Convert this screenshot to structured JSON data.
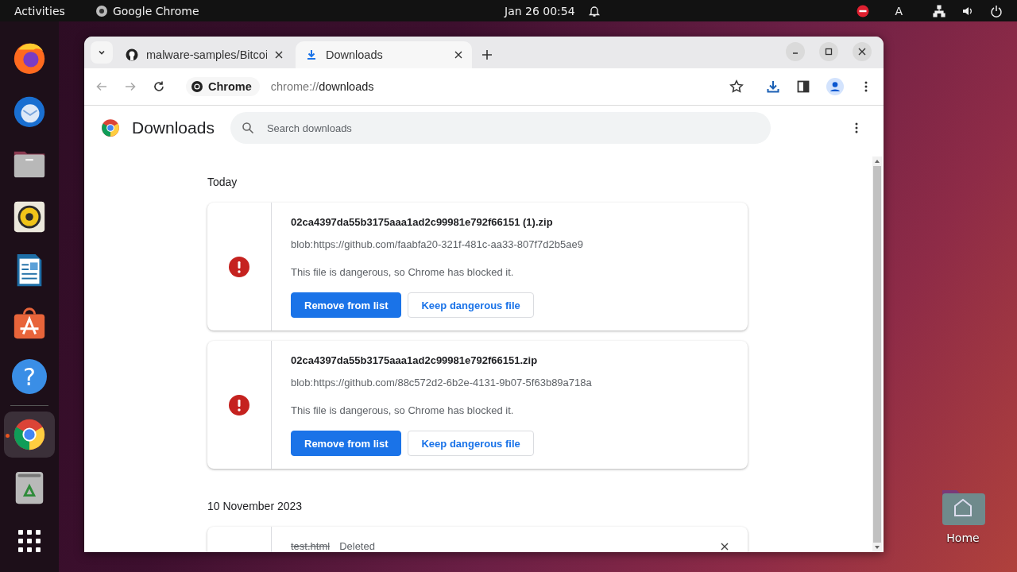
{
  "topbar": {
    "activities": "Activities",
    "app": "Google Chrome",
    "clock": "Jan 26  00:54",
    "keyboard": "A"
  },
  "dock": [
    {
      "kind": "firefox",
      "running": false
    },
    {
      "kind": "thunderbird",
      "running": false
    },
    {
      "kind": "files",
      "running": false
    },
    {
      "kind": "rhythmbox",
      "running": false
    },
    {
      "kind": "writer",
      "running": false
    },
    {
      "kind": "appstore",
      "running": false
    },
    {
      "kind": "help",
      "running": false,
      "glyph": "?"
    },
    {
      "kind": "chrome",
      "running": true
    },
    {
      "kind": "trash",
      "running": false
    },
    {
      "kind": "grid",
      "running": false
    }
  ],
  "tabs": [
    {
      "kind": "github",
      "title": "malware-samples/Bitcoi",
      "selected": false
    },
    {
      "kind": "download",
      "title": "Downloads",
      "selected": true
    }
  ],
  "address": {
    "chip": "Chrome",
    "scheme": "chrome://",
    "path": "downloads"
  },
  "page": {
    "title": "Downloads",
    "search_placeholder": "Search downloads"
  },
  "sections": [
    {
      "date": "Today",
      "items": [
        {
          "kind": "dangerous",
          "file": "02ca4397da55b3175aaa1ad2c99981e792f66151 (1).zip",
          "url": "blob:https://github.com/faabfa20-321f-481c-aa33-807f7d2b5ae9",
          "message": "This file is dangerous, so Chrome has blocked it.",
          "buttons": [
            "Remove from list",
            "Keep dangerous file"
          ]
        },
        {
          "kind": "dangerous",
          "file": "02ca4397da55b3175aaa1ad2c99981e792f66151.zip",
          "url": "blob:https://github.com/88c572d2-6b2e-4131-9b07-5f63b89a718a",
          "message": "This file is dangerous, so Chrome has blocked it.",
          "buttons": [
            "Remove from list",
            "Keep dangerous file"
          ]
        }
      ]
    },
    {
      "date": "10 November 2023",
      "items": [
        {
          "kind": "deleted",
          "file": "test.html",
          "status": "Deleted"
        }
      ]
    }
  ],
  "desktop": {
    "home_label": "Home"
  }
}
